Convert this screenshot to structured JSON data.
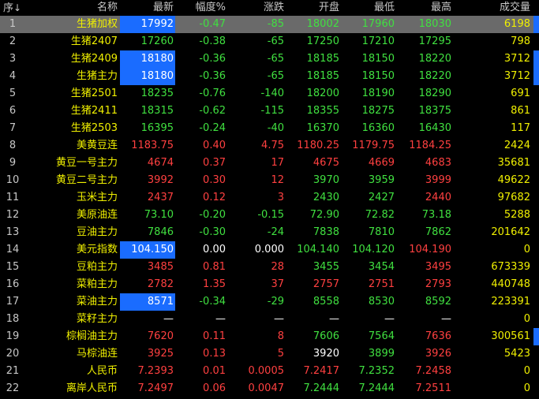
{
  "header": {
    "idx": "序",
    "sort_icon": "↓",
    "name": "名称",
    "last": "最新",
    "pct": "幅度%",
    "chg": "涨跌",
    "open": "开盘",
    "low": "最低",
    "high": "最高",
    "vol": "成交量"
  },
  "colors": {
    "up": "#ff4040",
    "down": "#40e040",
    "flat": "#ffffff",
    "name": "#f0f000",
    "highlight": "#1a6cff"
  },
  "rows": [
    {
      "idx": "1",
      "name": "生猪加权",
      "last": "17992",
      "pct": "-0.47",
      "chg": "-85",
      "open": "18002",
      "low": "17960",
      "high": "18030",
      "vol": "6198",
      "dir": "down",
      "open_dir": "down",
      "low_dir": "down",
      "high_dir": "down",
      "boxed": true,
      "selected": true,
      "scroll": true
    },
    {
      "idx": "2",
      "name": "生猪2407",
      "last": "17260",
      "pct": "-0.38",
      "chg": "-65",
      "open": "17250",
      "low": "17210",
      "high": "17295",
      "vol": "798",
      "dir": "down",
      "open_dir": "down",
      "low_dir": "down",
      "high_dir": "down",
      "boxed": false
    },
    {
      "idx": "3",
      "name": "生猪2409",
      "last": "18180",
      "pct": "-0.36",
      "chg": "-65",
      "open": "18185",
      "low": "18150",
      "high": "18220",
      "vol": "3712",
      "dir": "down",
      "open_dir": "down",
      "low_dir": "down",
      "high_dir": "down",
      "boxed": true,
      "scroll": true
    },
    {
      "idx": "4",
      "name": "生猪主力",
      "last": "18180",
      "pct": "-0.36",
      "chg": "-65",
      "open": "18185",
      "low": "18150",
      "high": "18220",
      "vol": "3712",
      "dir": "down",
      "open_dir": "down",
      "low_dir": "down",
      "high_dir": "down",
      "boxed": true,
      "scroll": true
    },
    {
      "idx": "5",
      "name": "生猪2501",
      "last": "18235",
      "pct": "-0.76",
      "chg": "-140",
      "open": "18200",
      "low": "18190",
      "high": "18290",
      "vol": "691",
      "dir": "down",
      "open_dir": "down",
      "low_dir": "down",
      "high_dir": "down",
      "boxed": false
    },
    {
      "idx": "6",
      "name": "生猪2411",
      "last": "18315",
      "pct": "-0.62",
      "chg": "-115",
      "open": "18355",
      "low": "18275",
      "high": "18375",
      "vol": "861",
      "dir": "down",
      "open_dir": "down",
      "low_dir": "down",
      "high_dir": "down",
      "boxed": false
    },
    {
      "idx": "7",
      "name": "生猪2503",
      "last": "16395",
      "pct": "-0.24",
      "chg": "-40",
      "open": "16370",
      "low": "16360",
      "high": "16430",
      "vol": "117",
      "dir": "down",
      "open_dir": "down",
      "low_dir": "down",
      "high_dir": "down",
      "boxed": false
    },
    {
      "idx": "8",
      "name": "美黄豆连",
      "last": "1183.75",
      "pct": "0.40",
      "chg": "4.75",
      "open": "1180.25",
      "low": "1179.75",
      "high": "1184.25",
      "vol": "2424",
      "dir": "up",
      "open_dir": "up",
      "low_dir": "up",
      "high_dir": "up",
      "boxed": false
    },
    {
      "idx": "9",
      "name": "黄豆一号主力",
      "last": "4674",
      "pct": "0.37",
      "chg": "17",
      "open": "4675",
      "low": "4669",
      "high": "4683",
      "vol": "35681",
      "dir": "up",
      "open_dir": "up",
      "low_dir": "up",
      "high_dir": "up",
      "boxed": false
    },
    {
      "idx": "10",
      "name": "黄豆二号主力",
      "last": "3992",
      "pct": "0.30",
      "chg": "12",
      "open": "3970",
      "low": "3959",
      "high": "3999",
      "vol": "49622",
      "dir": "up",
      "open_dir": "down",
      "low_dir": "down",
      "high_dir": "up",
      "boxed": false
    },
    {
      "idx": "11",
      "name": "玉米主力",
      "last": "2437",
      "pct": "0.12",
      "chg": "3",
      "open": "2430",
      "low": "2427",
      "high": "2440",
      "vol": "97682",
      "dir": "up",
      "open_dir": "down",
      "low_dir": "down",
      "high_dir": "up",
      "boxed": false
    },
    {
      "idx": "12",
      "name": "美原油连",
      "last": "73.10",
      "pct": "-0.20",
      "chg": "-0.15",
      "open": "72.90",
      "low": "72.82",
      "high": "73.18",
      "vol": "5288",
      "dir": "down",
      "open_dir": "down",
      "low_dir": "down",
      "high_dir": "down",
      "boxed": false
    },
    {
      "idx": "13",
      "name": "豆油主力",
      "last": "7846",
      "pct": "-0.30",
      "chg": "-24",
      "open": "7838",
      "low": "7810",
      "high": "7862",
      "vol": "201642",
      "dir": "down",
      "open_dir": "down",
      "low_dir": "down",
      "high_dir": "down",
      "boxed": false
    },
    {
      "idx": "14",
      "name": "美元指数",
      "last": "104.150",
      "pct": "0.00",
      "chg": "0.000",
      "open": "104.140",
      "low": "104.120",
      "high": "104.190",
      "vol": "0",
      "dir": "flat",
      "open_dir": "down",
      "low_dir": "down",
      "high_dir": "up",
      "boxed": true
    },
    {
      "idx": "15",
      "name": "豆粕主力",
      "last": "3485",
      "pct": "0.81",
      "chg": "28",
      "open": "3455",
      "low": "3454",
      "high": "3495",
      "vol": "673339",
      "dir": "up",
      "open_dir": "down",
      "low_dir": "down",
      "high_dir": "up",
      "boxed": false
    },
    {
      "idx": "16",
      "name": "菜粕主力",
      "last": "2782",
      "pct": "1.35",
      "chg": "37",
      "open": "2757",
      "low": "2751",
      "high": "2793",
      "vol": "440748",
      "dir": "up",
      "open_dir": "up",
      "low_dir": "up",
      "high_dir": "up",
      "boxed": false
    },
    {
      "idx": "17",
      "name": "菜油主力",
      "last": "8571",
      "pct": "-0.34",
      "chg": "-29",
      "open": "8558",
      "low": "8530",
      "high": "8592",
      "vol": "223391",
      "dir": "down",
      "open_dir": "down",
      "low_dir": "down",
      "high_dir": "down",
      "boxed": true
    },
    {
      "idx": "18",
      "name": "菜籽主力",
      "last": "—",
      "pct": "—",
      "chg": "—",
      "open": "—",
      "low": "—",
      "high": "—",
      "vol": "0",
      "dir": "flat",
      "open_dir": "flat",
      "low_dir": "flat",
      "high_dir": "flat",
      "boxed": false
    },
    {
      "idx": "19",
      "name": "棕榈油主力",
      "last": "7620",
      "pct": "0.11",
      "chg": "8",
      "open": "7606",
      "low": "7564",
      "high": "7636",
      "vol": "300561",
      "dir": "up",
      "open_dir": "down",
      "low_dir": "down",
      "high_dir": "up",
      "boxed": false,
      "scroll": true
    },
    {
      "idx": "20",
      "name": "马棕油连",
      "last": "3925",
      "pct": "0.13",
      "chg": "5",
      "open": "3920",
      "low": "3899",
      "high": "3926",
      "vol": "5423",
      "dir": "up",
      "open_dir": "flat",
      "low_dir": "down",
      "high_dir": "up",
      "boxed": false
    },
    {
      "idx": "21",
      "name": "人民币",
      "last": "7.2393",
      "pct": "0.01",
      "chg": "0.0005",
      "open": "7.2417",
      "low": "7.2352",
      "high": "7.2458",
      "vol": "0",
      "dir": "up",
      "open_dir": "up",
      "low_dir": "down",
      "high_dir": "up",
      "boxed": false
    },
    {
      "idx": "22",
      "name": "离岸人民币",
      "last": "7.2497",
      "pct": "0.06",
      "chg": "0.0047",
      "open": "7.2444",
      "low": "7.2444",
      "high": "7.2511",
      "vol": "0",
      "dir": "up",
      "open_dir": "down",
      "low_dir": "down",
      "high_dir": "up",
      "boxed": false
    }
  ]
}
